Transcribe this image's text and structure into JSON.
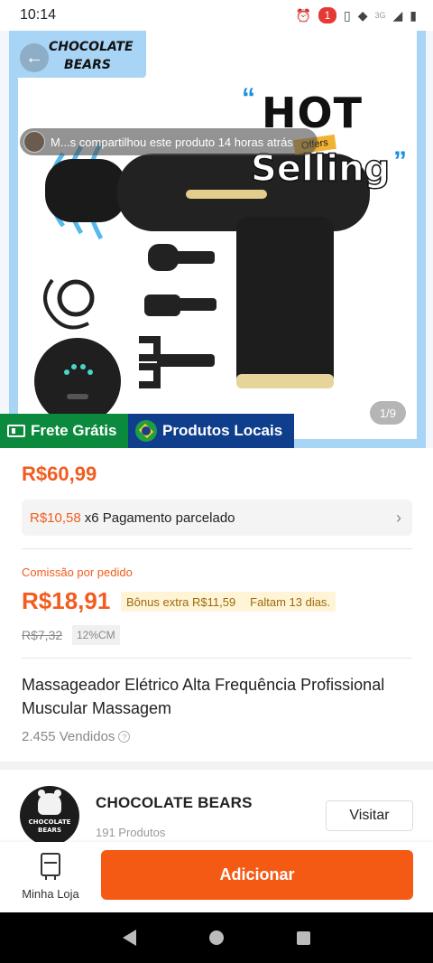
{
  "status_bar": {
    "time": "10:14",
    "notification_count": "1",
    "network": "3G"
  },
  "hero": {
    "brand_line1": "CHOCOLATE",
    "brand_line2": "BEARS",
    "headline_1": "HOT",
    "headline_2": "Selling",
    "ribbon_text": "Offers",
    "share_text": "M...s compartilhou este produto 14 horas atrás",
    "image_counter": "1/9",
    "tag_shipping": "Frete Grátis",
    "tag_local": "Produtos Locais"
  },
  "product": {
    "price": "R$60,99",
    "installment_value": "R$10,58",
    "installment_rest": "x6 Pagamento parcelado",
    "commission_label": "Comissão por pedido",
    "commission_value": "R$18,91",
    "bonus_text": "Bônus extra R$11,59",
    "bonus_deadline": "Faltam 13 dias.",
    "old_commission": "R$7,32",
    "commission_rate": "12%CM",
    "title": "Massageador Elétrico Alta Frequência Profissional Muscular Massagem",
    "sold": "2.455 Vendidos"
  },
  "shop": {
    "logo_text_1": "CHOCOLATE",
    "logo_text_2": "BEARS",
    "name": "CHOCOLATE BEARS",
    "products": "191 Produtos",
    "visit_label": "Visitar"
  },
  "bottom_bar": {
    "store_label": "Minha Loja",
    "add_label": "Adicionar"
  },
  "colors": {
    "accent": "#f55a14",
    "price": "#f25c1f",
    "frete_tag": "#0b8a3e",
    "locais_tag": "#0e3e8c",
    "frame_blue": "#a8d4f5"
  }
}
